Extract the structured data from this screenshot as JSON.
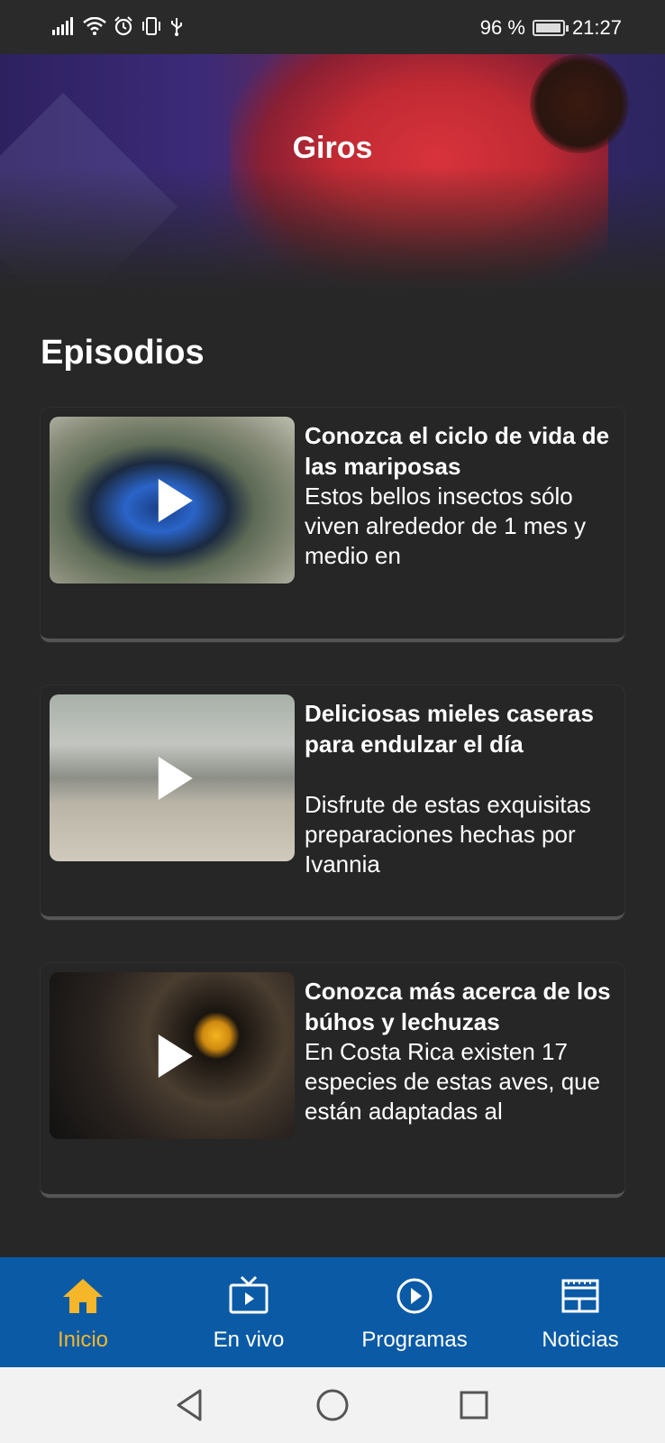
{
  "status_bar": {
    "battery_percent": "96 %",
    "time": "21:27"
  },
  "hero": {
    "title": "Giros"
  },
  "section": {
    "title": "Episodios"
  },
  "episodes": [
    {
      "title": "Conozca el ciclo de vida de las mariposas",
      "description": "Estos bellos insectos sólo viven alrededor de 1 mes y medio en"
    },
    {
      "title": "Deliciosas mieles caseras para endulzar el día",
      "description": "Disfrute de estas exquisitas preparaciones hechas por Ivannia"
    },
    {
      "title": "Conozca más acerca de los búhos y lechuzas",
      "description": "En Costa Rica existen 17 especies de estas aves, que están adaptadas al"
    }
  ],
  "bottom_nav": {
    "items": [
      {
        "label": "Inicio",
        "icon": "home-icon",
        "active": true
      },
      {
        "label": "En vivo",
        "icon": "tv-play-icon",
        "active": false
      },
      {
        "label": "Programas",
        "icon": "play-circle-icon",
        "active": false
      },
      {
        "label": "Noticias",
        "icon": "newspaper-icon",
        "active": false
      }
    ]
  },
  "colors": {
    "background": "#272727",
    "nav_background": "#0a5aa6",
    "active_accent": "#f5b62a"
  }
}
